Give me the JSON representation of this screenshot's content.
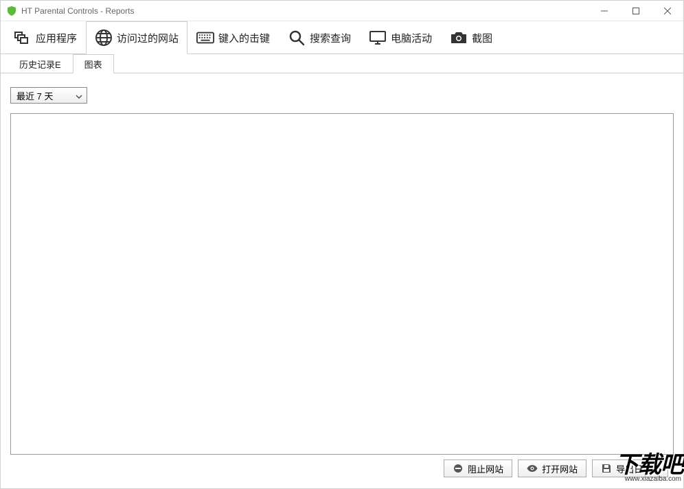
{
  "window": {
    "title": "HT Parental Controls - Reports"
  },
  "top_tabs": [
    {
      "label": "应用程序",
      "icon": "windows"
    },
    {
      "label": "访问过的网站",
      "icon": "globe",
      "active": true
    },
    {
      "label": "键入的击键",
      "icon": "keyboard"
    },
    {
      "label": "搜索查询",
      "icon": "search"
    },
    {
      "label": "电脑活动",
      "icon": "monitor"
    },
    {
      "label": "截图",
      "icon": "camera"
    }
  ],
  "sub_tabs": [
    {
      "label": "历史记录E"
    },
    {
      "label": "图表",
      "active": true
    }
  ],
  "range_selector": {
    "value": "最近 7 天"
  },
  "actions": {
    "block": "阻止网站",
    "open": "打开网站",
    "export": "导出日志..."
  },
  "watermark": {
    "main": "下载吧",
    "sub": "www.xiazaiba.com"
  }
}
